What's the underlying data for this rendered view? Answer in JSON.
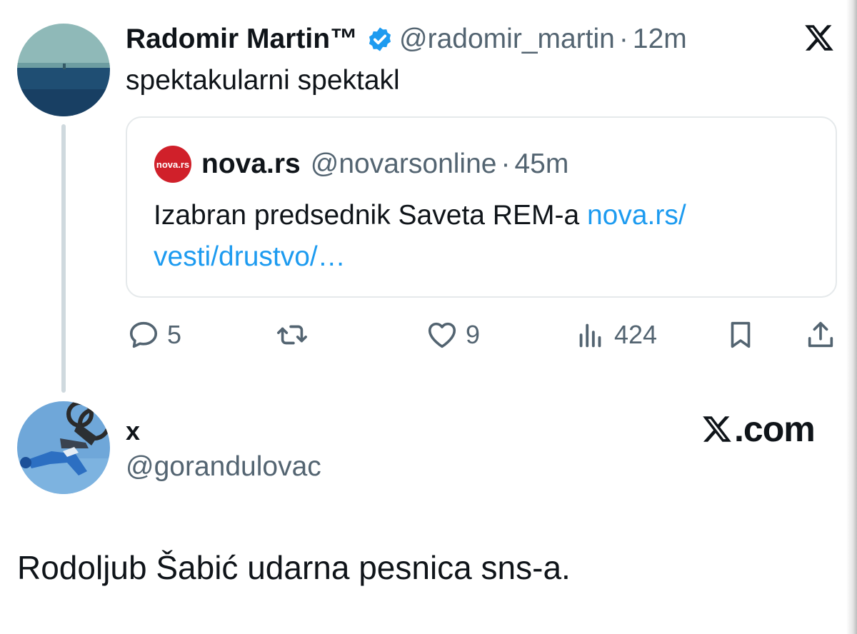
{
  "tweet": {
    "author_name": "Radomir Martin™",
    "handle": "@radomir_martin",
    "separator": "·",
    "time": "12m",
    "text": "spektakularni spektakl",
    "quote": {
      "logo_text": "nova.rs",
      "author_name": "nova.rs",
      "handle": "@novarsonline",
      "separator": "·",
      "time": "45m",
      "text": "Izabran predsednik Saveta REM-a ",
      "link_line1": "nova.rs/",
      "link_line2": "vesti/drustvo/…"
    },
    "actions": {
      "replies": "5",
      "likes": "9",
      "views": "424"
    }
  },
  "post": {
    "author_name": "x",
    "handle": "@gorandulovac",
    "brand": ".com",
    "text": "Rodoljub Šabić udarna pesnica sns-a."
  },
  "colors": {
    "accent": "#1d9bf0",
    "muted": "#536471",
    "border": "#e5e9eb",
    "nova_red": "#d0202a"
  },
  "icons": [
    "verified-badge-icon",
    "x-logo-icon",
    "reply-icon",
    "retweet-icon",
    "like-icon",
    "views-icon",
    "bookmark-icon",
    "share-icon"
  ]
}
